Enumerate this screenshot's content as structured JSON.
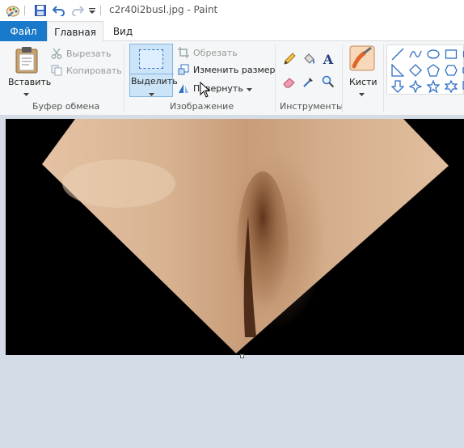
{
  "window": {
    "title": "c2r40i2busl.jpg - Paint"
  },
  "tabs": {
    "file": "Файл",
    "home": "Главная",
    "view": "Вид"
  },
  "ribbon": {
    "clipboard": {
      "paste_label": "Вставить",
      "cut_label": "Вырезать",
      "copy_label": "Копировать",
      "group_label": "Буфер обмена"
    },
    "image": {
      "select_label": "Выделить",
      "crop_label": "Обрезать",
      "resize_label": "Изменить размер",
      "rotate_label": "Повернуть",
      "group_label": "Изображение"
    },
    "tools": {
      "group_label": "Инструменты",
      "items": [
        "pencil-icon",
        "fill-icon",
        "text-icon",
        "eraser-icon",
        "color-picker-icon",
        "magnifier-icon"
      ]
    },
    "brushes": {
      "label": "Кисти"
    },
    "shapes": {
      "items": [
        "line-icon",
        "curve-icon",
        "oval-icon",
        "rectangle-icon",
        "rounded-rectangle-icon",
        "triangle-icon",
        "diamond-icon",
        "pentagon-icon",
        "hexagon-icon",
        "arrow-right-icon",
        "arrow-down-icon",
        "star4-icon",
        "star5-icon",
        "star6-icon",
        "callout-icon"
      ]
    }
  },
  "colors": {
    "accent": "#1979ca",
    "ribbon_bg": "#f5f6f7",
    "workspace_bg": "#d4dce8",
    "canvas_bg": "#000000"
  }
}
